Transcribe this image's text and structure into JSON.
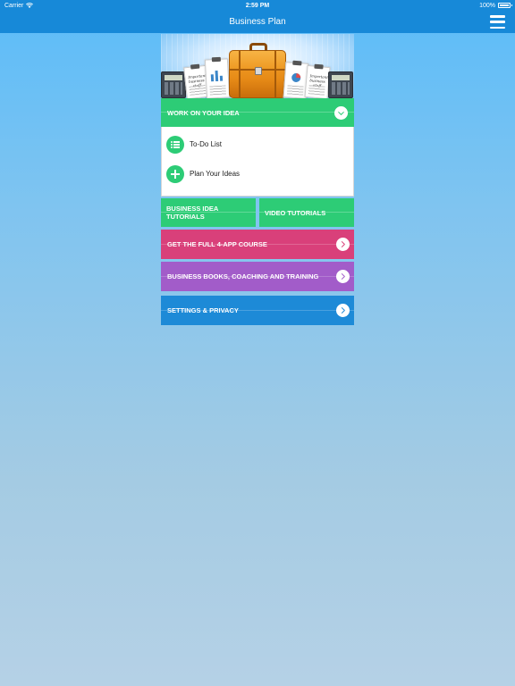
{
  "status_bar": {
    "carrier": "Carrier",
    "time": "2:59 PM",
    "battery": "100%"
  },
  "nav": {
    "title": "Business Plan"
  },
  "hero": {
    "paper_text": "Important business stuff"
  },
  "work_panel": {
    "header": "WORK ON YOUR IDEA",
    "items": [
      {
        "label": "To-Do List",
        "icon": "list-icon"
      },
      {
        "label": "Plan Your Ideas",
        "icon": "plus-icon"
      }
    ]
  },
  "tiles": [
    {
      "label": "BUSINESS IDEA TUTORIALS"
    },
    {
      "label": "VIDEO TUTORIALS"
    }
  ],
  "bars": [
    {
      "label": "GET THE FULL 4-APP COURSE",
      "color": "#d9407a"
    },
    {
      "label": "BUSINESS BOOKS, COACHING AND TRAINING",
      "color": "#a25cc9"
    },
    {
      "label": "SETTINGS & PRIVACY",
      "color": "#1d8ad7"
    }
  ],
  "colors": {
    "accent_green": "#2dcc76",
    "nav_blue": "#1789d8"
  }
}
